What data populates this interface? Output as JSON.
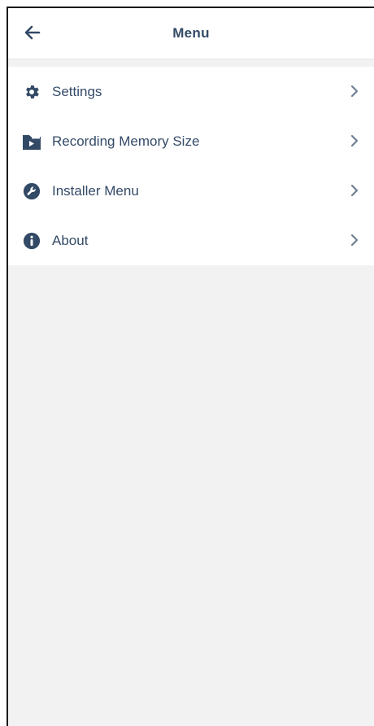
{
  "header": {
    "title": "Menu",
    "back_icon": "arrow-left-icon"
  },
  "menu": {
    "items": [
      {
        "label": "Settings",
        "icon": "gear-icon"
      },
      {
        "label": "Recording Memory Size",
        "icon": "video-folder-icon"
      },
      {
        "label": "Installer Menu",
        "icon": "wrench-icon"
      },
      {
        "label": "About",
        "icon": "info-icon"
      }
    ]
  },
  "colors": {
    "primary": "#334a66",
    "background": "#f2f2f2",
    "surface": "#ffffff",
    "chevron": "#6f7f92"
  }
}
